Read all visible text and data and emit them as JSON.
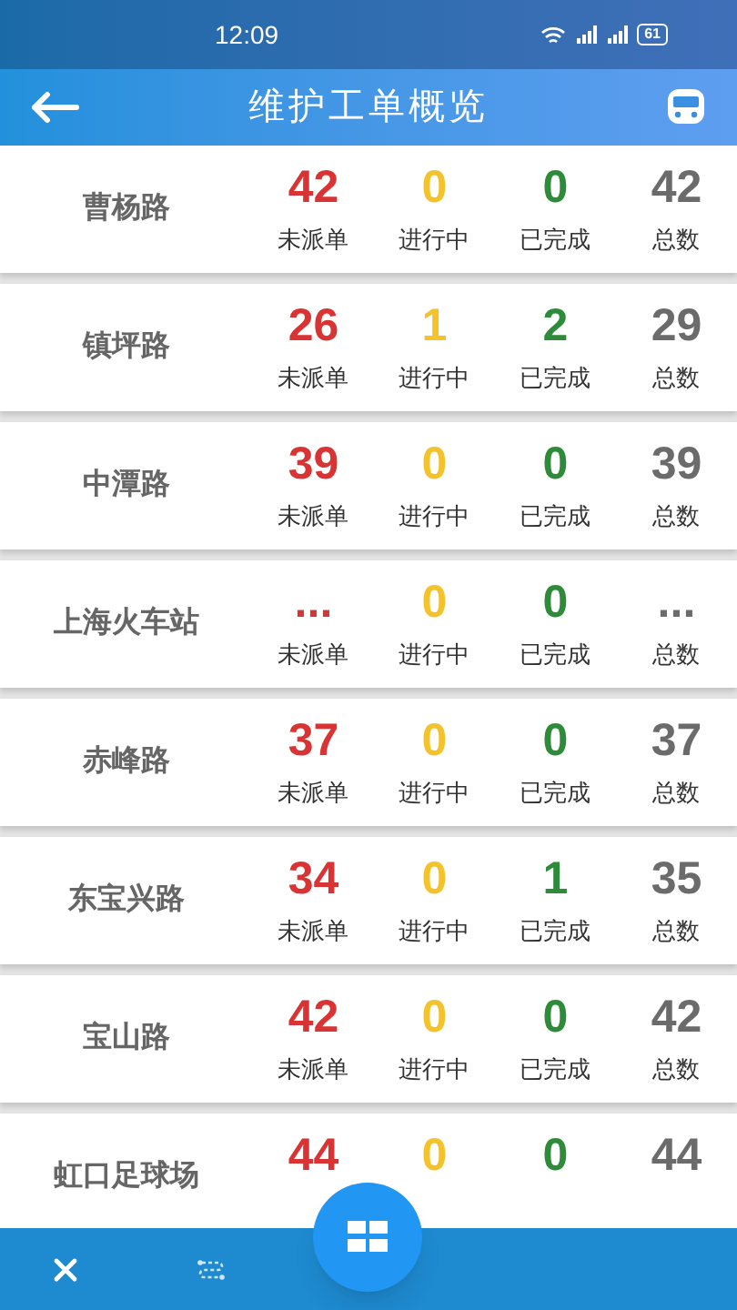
{
  "status_bar": {
    "time": "12:09",
    "battery": "61"
  },
  "app_bar": {
    "title": "维护工单概览"
  },
  "stations": [
    {
      "name": "曹杨路",
      "stats": [
        {
          "kind": "pending",
          "value": "42",
          "label": "未派单"
        },
        {
          "kind": "in_progress",
          "value": "0",
          "label": "进行中"
        },
        {
          "kind": "done",
          "value": "0",
          "label": "已完成"
        },
        {
          "kind": "total",
          "value": "42",
          "label": "总数"
        }
      ]
    },
    {
      "name": "镇坪路",
      "stats": [
        {
          "kind": "pending",
          "value": "26",
          "label": "未派单"
        },
        {
          "kind": "in_progress",
          "value": "1",
          "label": "进行中"
        },
        {
          "kind": "done",
          "value": "2",
          "label": "已完成"
        },
        {
          "kind": "total",
          "value": "29",
          "label": "总数"
        }
      ]
    },
    {
      "name": "中潭路",
      "stats": [
        {
          "kind": "pending",
          "value": "39",
          "label": "未派单"
        },
        {
          "kind": "in_progress",
          "value": "0",
          "label": "进行中"
        },
        {
          "kind": "done",
          "value": "0",
          "label": "已完成"
        },
        {
          "kind": "total",
          "value": "39",
          "label": "总数"
        }
      ]
    },
    {
      "name": "上海火车站",
      "stats": [
        {
          "kind": "pending",
          "value": "...",
          "label": "未派单"
        },
        {
          "kind": "in_progress",
          "value": "0",
          "label": "进行中"
        },
        {
          "kind": "done",
          "value": "0",
          "label": "已完成"
        },
        {
          "kind": "total",
          "value": "...",
          "label": "总数"
        }
      ]
    },
    {
      "name": "赤峰路",
      "stats": [
        {
          "kind": "pending",
          "value": "37",
          "label": "未派单"
        },
        {
          "kind": "in_progress",
          "value": "0",
          "label": "进行中"
        },
        {
          "kind": "done",
          "value": "0",
          "label": "已完成"
        },
        {
          "kind": "total",
          "value": "37",
          "label": "总数"
        }
      ]
    },
    {
      "name": "东宝兴路",
      "stats": [
        {
          "kind": "pending",
          "value": "34",
          "label": "未派单"
        },
        {
          "kind": "in_progress",
          "value": "0",
          "label": "进行中"
        },
        {
          "kind": "done",
          "value": "1",
          "label": "已完成"
        },
        {
          "kind": "total",
          "value": "35",
          "label": "总数"
        }
      ]
    },
    {
      "name": "宝山路",
      "stats": [
        {
          "kind": "pending",
          "value": "42",
          "label": "未派单"
        },
        {
          "kind": "in_progress",
          "value": "0",
          "label": "进行中"
        },
        {
          "kind": "done",
          "value": "0",
          "label": "已完成"
        },
        {
          "kind": "total",
          "value": "42",
          "label": "总数"
        }
      ]
    },
    {
      "name": "虹口足球场",
      "stats": [
        {
          "kind": "pending",
          "value": "44"
        },
        {
          "kind": "in_progress",
          "value": "0"
        },
        {
          "kind": "done",
          "value": "0"
        },
        {
          "kind": "total",
          "value": "44"
        }
      ]
    }
  ]
}
